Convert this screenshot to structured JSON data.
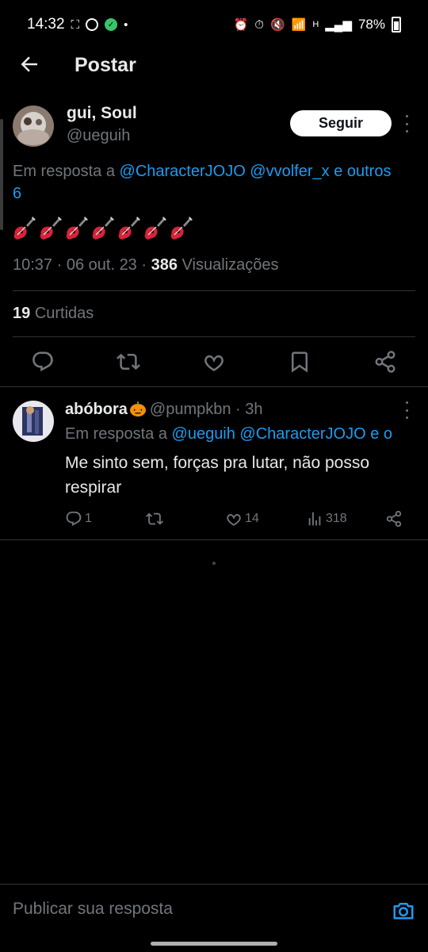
{
  "status_bar": {
    "time": "14:32",
    "signal": "H",
    "battery": "78%"
  },
  "header": {
    "title": "Postar"
  },
  "tweet": {
    "author_name": "gui, Soul",
    "handle": "@ueguih",
    "follow_label": "Seguir",
    "reply_prefix": "Em resposta a",
    "reply_mentions": "@CharacterJOJO @vvolfer_x e outros",
    "reply_overflow": "6",
    "guitar_count": 7,
    "time": "10:37",
    "date": "06 out. 23",
    "views_count": "386",
    "views_label": "Visualizações",
    "likes_count": "19",
    "likes_label": "Curtidas"
  },
  "reply": {
    "author_name": "abóbora",
    "handle": "@pumpkbn",
    "age": "3h",
    "reply_prefix": "Em resposta a",
    "reply_mentions": "@ueguih @CharacterJOJO e o",
    "text": "Me sinto sem, forças pra lutar, não posso respirar",
    "reply_count": "1",
    "like_count": "14",
    "view_count": "318"
  },
  "composer": {
    "placeholder": "Publicar sua resposta"
  },
  "colors": {
    "background": "#000000",
    "text": "#e7e9ea",
    "muted": "#71767b",
    "link": "#1d9bf0",
    "divider": "#2f3336"
  }
}
